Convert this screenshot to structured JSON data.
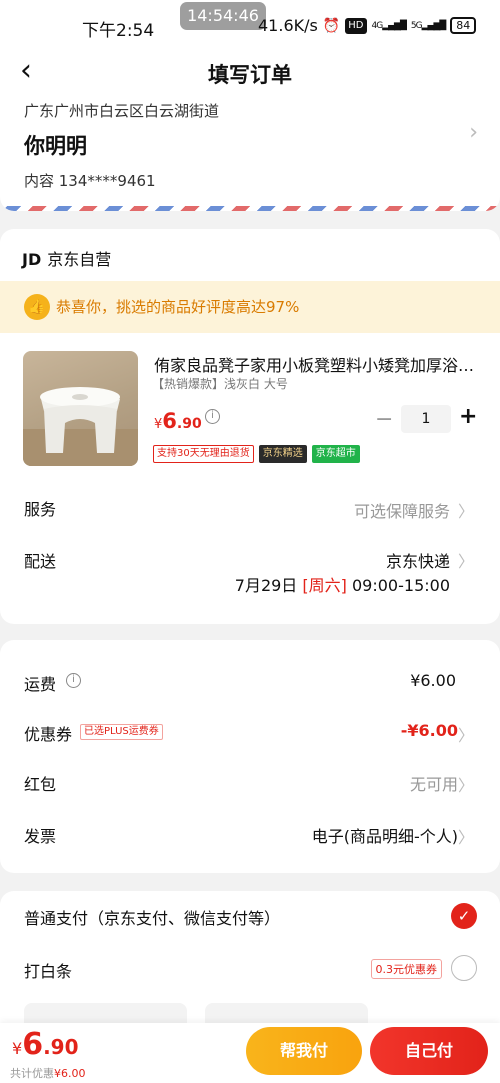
{
  "status_bar": {
    "time": "下午2:54",
    "overlay_time": "14:54:46",
    "net_speed": "41.6K/s",
    "hd": "HD",
    "net1": "4G",
    "net2": "5G",
    "battery": "84"
  },
  "header": {
    "back_icon": "‹",
    "title": "填写订单"
  },
  "address": {
    "line": "广东广州市白云区白云湖街道",
    "name": "你明明",
    "phone": "内容  134****9461",
    "chevron": "›"
  },
  "shop": {
    "logo": "JD",
    "name": "京东自营",
    "praise_text": "恭喜你，挑选的商品好评度高达97%"
  },
  "product": {
    "name": "侑家良品凳子家用小板凳塑料小矮凳加厚浴室凳",
    "spec": "【热销爆款】浅灰白 大号",
    "price_currency": "¥",
    "price_int": "6",
    "price_dec": ".90",
    "quantity": "1",
    "tags": [
      "支持30天无理由退货",
      "京东精选",
      "京东超市"
    ]
  },
  "service": {
    "label": "服务",
    "value": "可选保障服务"
  },
  "delivery": {
    "label": "配送",
    "carrier": "京东快递",
    "date": "7月29日",
    "weekday": "[周六]",
    "time": "09:00-15:00"
  },
  "fees": {
    "shipping_label": "运费",
    "shipping_value": "¥6.00",
    "coupon_label": "优惠券",
    "coupon_tag": "已选PLUS运费券",
    "coupon_value": "-¥6.00",
    "redpacket_label": "红包",
    "redpacket_value": "无可用",
    "invoice_label": "发票",
    "invoice_value": "电子(商品明细-个人)"
  },
  "payment": {
    "normal_label": "普通支付（京东支付、微信支付等）",
    "baitiao_label": "打白条",
    "baitiao_coupon": "0.3元优惠券"
  },
  "bottom": {
    "currency": "¥",
    "total_int": "6",
    "total_dec": ".90",
    "discount_label": "共计优惠",
    "discount_value": "¥6.00",
    "help_pay": "帮我付",
    "self_pay": "自己付"
  },
  "colors": {
    "accent_red": "#e2231a",
    "help_pay_orange": "#f9b41b",
    "praise_bg": "#fdf3d9"
  }
}
